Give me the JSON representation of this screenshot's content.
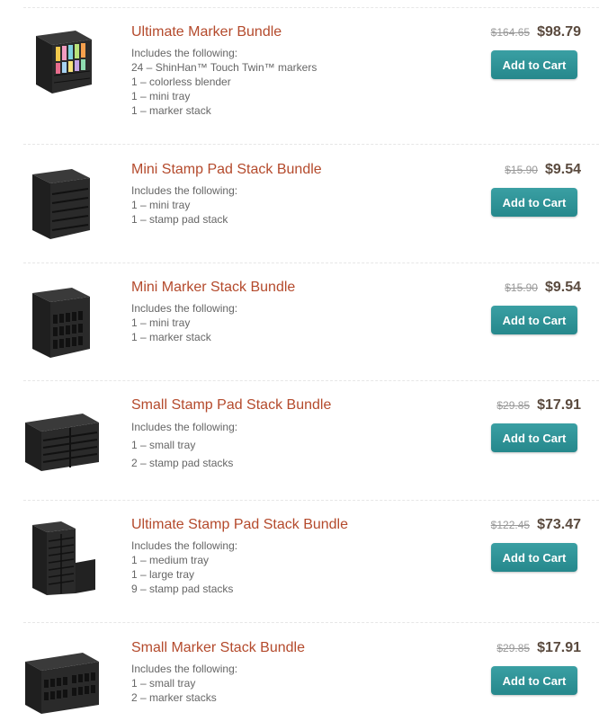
{
  "items": [
    {
      "title": "Ultimate Marker Bundle",
      "includes_label": "Includes the following:",
      "lines": [
        "24 – ShinHan™ Touch Twin™ markers",
        "1 – colorless blender",
        "1 – mini tray",
        "1 – marker stack"
      ],
      "old_price": "$164.65",
      "price": "$98.79",
      "cta": "Add to Cart",
      "image": "marker-cube-with-markers-image"
    },
    {
      "title": "Mini Stamp Pad Stack Bundle",
      "includes_label": "Includes the following:",
      "lines": [
        "1 – mini tray",
        "1 – stamp pad stack"
      ],
      "old_price": "$15.90",
      "price": "$9.54",
      "cta": "Add to Cart",
      "image": "mini-stamp-pad-stack-image"
    },
    {
      "title": "Mini Marker Stack Bundle",
      "includes_label": "Includes the following:",
      "lines": [
        "1 – mini tray",
        "1 – marker stack"
      ],
      "old_price": "$15.90",
      "price": "$9.54",
      "cta": "Add to Cart",
      "image": "mini-marker-stack-image"
    },
    {
      "title": "Small Stamp Pad Stack Bundle",
      "includes_label": "Includes the following:",
      "lines": [
        "1 – small tray",
        "2 – stamp pad stacks"
      ],
      "old_price": "$29.85",
      "price": "$17.91",
      "cta": "Add to Cart",
      "image": "small-stamp-pad-stack-image"
    },
    {
      "title": "Ultimate Stamp Pad Stack Bundle",
      "includes_label": "Includes the following:",
      "lines": [
        "1 – medium tray",
        "1 – large tray",
        "9 – stamp pad stacks"
      ],
      "old_price": "$122.45",
      "price": "$73.47",
      "cta": "Add to Cart",
      "image": "ultimate-stamp-pad-stack-image"
    },
    {
      "title": "Small Marker Stack Bundle",
      "includes_label": "Includes the following:",
      "lines": [
        "1 – small tray",
        "2 – marker stacks"
      ],
      "old_price": "$29.85",
      "price": "$17.91",
      "cta": "Add to Cart",
      "image": "small-marker-stack-image"
    }
  ],
  "colors": {
    "title": "#b44a2c",
    "price": "#5a4a3e",
    "old_price": "#999999",
    "button": "#2b8f93"
  }
}
